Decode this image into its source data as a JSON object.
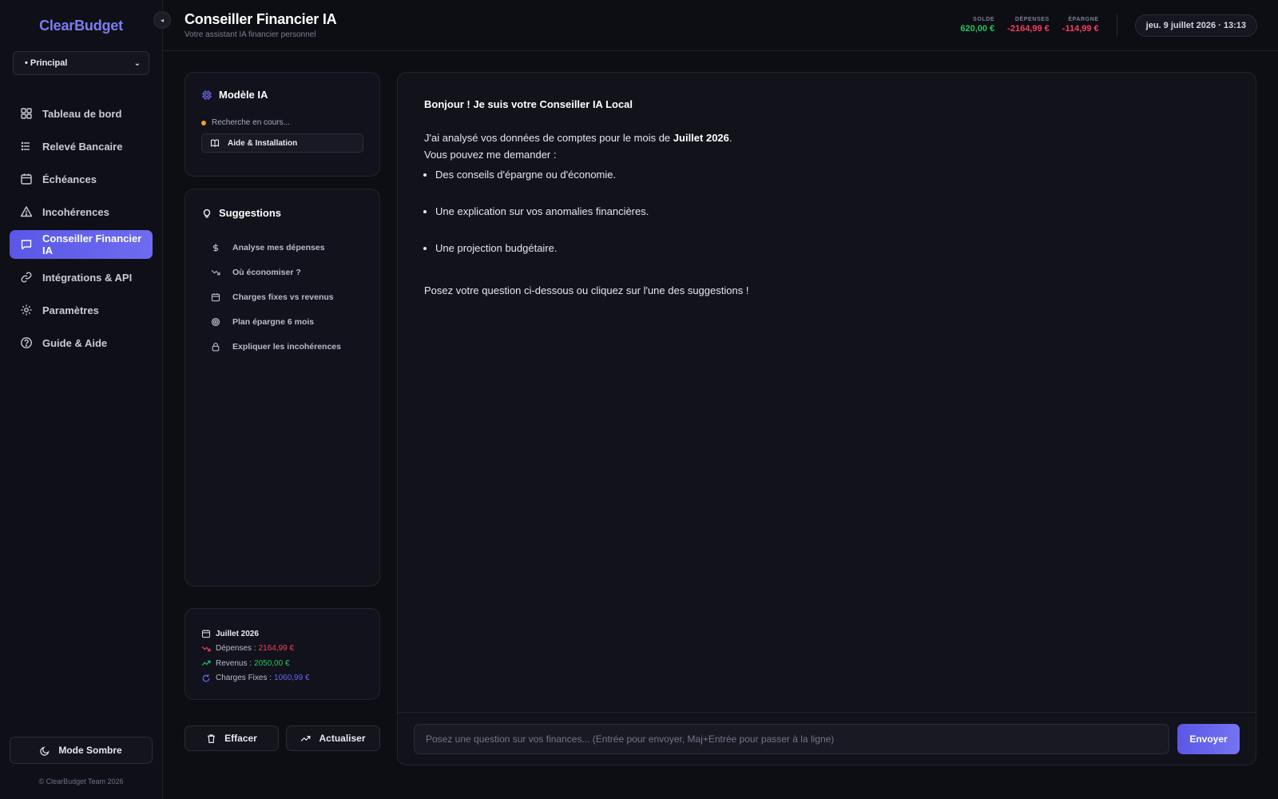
{
  "app": {
    "brand": "ClearBudget",
    "collapse_glyph": "◂"
  },
  "account": {
    "selected": "• Principal"
  },
  "sidebar": {
    "items": [
      {
        "label": "Tableau de bord",
        "icon": "grid-icon"
      },
      {
        "label": "Relevé Bancaire",
        "icon": "list-icon"
      },
      {
        "label": "Échéances",
        "icon": "calendar-icon"
      },
      {
        "label": "Incohérences",
        "icon": "warning-icon"
      },
      {
        "label": "Conseiller Financier IA",
        "icon": "chat-icon",
        "active": true
      },
      {
        "label": "Intégrations & API",
        "icon": "link-icon"
      },
      {
        "label": "Paramètres",
        "icon": "gear-icon"
      },
      {
        "label": "Guide & Aide",
        "icon": "help-circle-icon"
      }
    ],
    "theme_button": "Mode Sombre",
    "copyright": "© ClearBudget Team 2026"
  },
  "header": {
    "title": "Conseiller Financier IA",
    "subtitle": "Votre assistant IA financier personnel",
    "stats": [
      {
        "label": "SOLDE",
        "value": "620,00 €",
        "color": "#22c55e"
      },
      {
        "label": "DÉPENSES",
        "value": "-2164,99 €",
        "color": "#f43f5e"
      },
      {
        "label": "ÉPARGNE",
        "value": "-114,99 €",
        "color": "#f43f5e"
      }
    ],
    "datetime": "jeu. 9 juillet 2026 · 13:13"
  },
  "model_card": {
    "title": "Modèle IA",
    "status": "Recherche en cours...",
    "help_button": "Aide & Installation"
  },
  "suggestions": {
    "title": "Suggestions",
    "items": [
      {
        "label": "Analyse mes dépenses",
        "icon": "dollar-icon"
      },
      {
        "label": "Où économiser ?",
        "icon": "trend-down-icon"
      },
      {
        "label": "Charges fixes vs revenus",
        "icon": "calendar-icon"
      },
      {
        "label": "Plan épargne 6 mois",
        "icon": "target-icon"
      },
      {
        "label": "Expliquer les incohérences",
        "icon": "lock-icon"
      }
    ]
  },
  "month_summary": {
    "month": "Juillet 2026",
    "expenses_label": "Dépenses :",
    "expenses_value": "2164,99 €",
    "income_label": "Revenus :",
    "income_value": "2050,00 €",
    "fixed_label": "Charges Fixes :",
    "fixed_value": "1060,99 €",
    "colors": {
      "expenses": "#f43f5e",
      "income": "#22c55e",
      "fixed": "#6366f1"
    }
  },
  "actions": {
    "clear": "Effacer",
    "refresh": "Actualiser"
  },
  "chat": {
    "greeting": "Bonjour ! Je suis votre Conseiller IA Local",
    "intro_before": "J'ai analysé vos données de comptes pour le mois de ",
    "intro_month": "Juillet 2026",
    "intro_after": ".",
    "ask_line": "Vous pouvez me demander :",
    "bullets": [
      "Des conseils d'épargne ou d'économie.",
      "Une explication sur vos anomalies financières.",
      "Une projection budgétaire."
    ],
    "closing": "Posez votre question ci-dessous ou cliquez sur l'une des suggestions !",
    "input_placeholder": "Posez une question sur vos finances... (Entrée pour envoyer, Maj+Entrée pour passer à la ligne)",
    "send": "Envoyer"
  }
}
